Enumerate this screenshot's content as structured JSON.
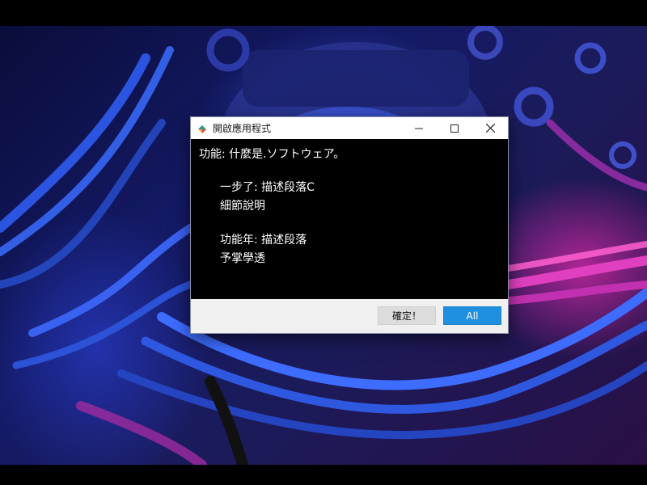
{
  "dialog": {
    "title": "開啟應用程式",
    "heading": "功能: 什麼是.ソフトウェア。",
    "items": [
      {
        "line1": "一步了: 描述段落C",
        "line2": "細節說明"
      },
      {
        "line1": "功能年: 描述段落",
        "line2": "予掌學透"
      }
    ],
    "buttons": {
      "secondary": "確定！",
      "primary": "All"
    }
  },
  "colors": {
    "accent": "#1f8fe0",
    "window_bg": "#000000",
    "footer_bg": "#f0f0f0"
  },
  "icons": {
    "app": "app-logo-icon",
    "minimize": "minimize-icon",
    "maximize": "maximize-icon",
    "close": "close-icon"
  }
}
